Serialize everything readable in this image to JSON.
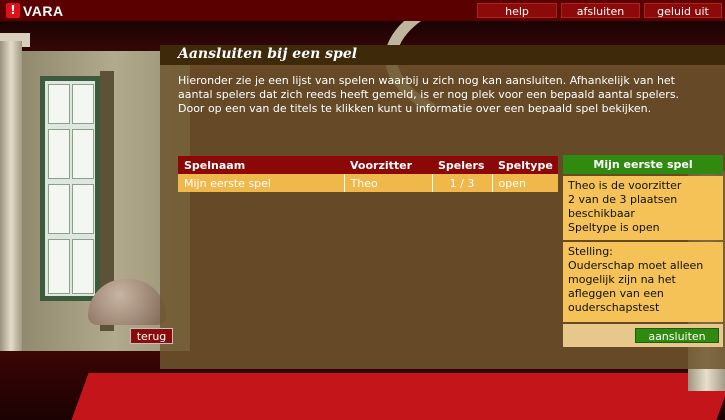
{
  "brand": {
    "mark": "!",
    "name": "VARA"
  },
  "topbar": {
    "help": "help",
    "close": "afsluiten",
    "sound": "geluid uit"
  },
  "panel": {
    "title": "Aansluiten bij een spel",
    "intro": "Hieronder zie je een lijst van spelen waarbij u zich nog kan aansluiten. Afhankelijk van het aantal spelers dat zich reeds heeft gemeld, is er nog plek voor een bepaald aantal spelers. Door op een van de titels te klikken kunt u informatie over een bepaald spel bekijken."
  },
  "table": {
    "headers": [
      "Spelnaam",
      "Voorzitter",
      "Spelers",
      "Speltype"
    ],
    "rows": [
      {
        "name": "Mijn eerste spel",
        "chair": "Theo",
        "players": "1 / 3",
        "type": "open"
      }
    ]
  },
  "info": {
    "title": "Mijn eerste spel",
    "details": [
      "Theo is de voorzitter",
      "2 van de 3 plaatsen beschikbaar",
      "Speltype is open"
    ],
    "statement_label": "Stelling:",
    "statement": "Ouderschap moet alleen mogelijk zijn na het afleggen van een ouderschapstest",
    "join_label": "aansluiten"
  },
  "back_label": "terug",
  "colors": {
    "topbar": "#5a0000",
    "header_red": "#8c0707",
    "row_orange": "#f0b84a",
    "accent_green": "#2f8a0f"
  }
}
